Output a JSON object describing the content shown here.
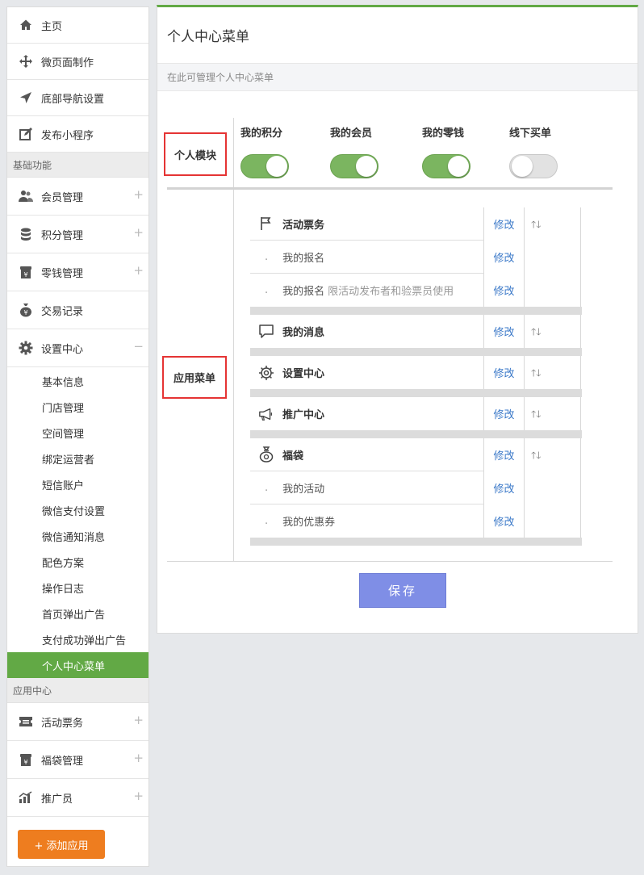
{
  "sidebar": {
    "top_items": [
      {
        "label": "主页",
        "icon": "home-icon"
      },
      {
        "label": "微页面制作",
        "icon": "move-icon"
      },
      {
        "label": "底部导航设置",
        "icon": "navigation-arrow-icon"
      },
      {
        "label": "发布小程序",
        "icon": "edit-icon"
      }
    ],
    "section_basic": "基础功能",
    "basic_items": [
      {
        "label": "会员管理",
        "icon": "users-icon",
        "toggle": "+"
      },
      {
        "label": "积分管理",
        "icon": "database-icon",
        "toggle": "+"
      },
      {
        "label": "零钱管理",
        "icon": "wallet-icon",
        "toggle": "+"
      },
      {
        "label": "交易记录",
        "icon": "money-bag-icon",
        "toggle": ""
      },
      {
        "label": "设置中心",
        "icon": "gear-icon",
        "toggle": "−"
      }
    ],
    "settings_subitems": [
      "基本信息",
      "门店管理",
      "空间管理",
      "绑定运营者",
      "短信账户",
      "微信支付设置",
      "微信通知消息",
      "配色方案",
      "操作日志",
      "首页弹出广告",
      "支付成功弹出广告",
      "个人中心菜单"
    ],
    "section_apps": "应用中心",
    "app_items": [
      {
        "label": "活动票务",
        "icon": "ticket-icon",
        "toggle": "+"
      },
      {
        "label": "福袋管理",
        "icon": "lucky-bag-icon",
        "toggle": "+"
      },
      {
        "label": "推广员",
        "icon": "bar-chart-icon",
        "toggle": "+"
      }
    ],
    "add_app_label": "+ 添加应用"
  },
  "main": {
    "title": "个人中心菜单",
    "description": "在此可管理个人中心菜单",
    "personal_module_label": "个人模块",
    "app_menu_label": "应用菜单",
    "modules": [
      {
        "label": "我的积分",
        "enabled": true
      },
      {
        "label": "我的会员",
        "enabled": true
      },
      {
        "label": "我的零钱",
        "enabled": true
      },
      {
        "label": "线下买单",
        "enabled": false
      }
    ],
    "edit_label": "修改",
    "sort_label": "🡑🡓",
    "menus": [
      {
        "name": "活动票务",
        "icon": "flag-icon",
        "children": [
          {
            "name": "我的报名",
            "note": ""
          },
          {
            "name": "我的报名",
            "note": "限活动发布者和验票员使用"
          }
        ]
      },
      {
        "name": "我的消息",
        "icon": "message-icon",
        "children": []
      },
      {
        "name": "设置中心",
        "icon": "gear-icon",
        "children": []
      },
      {
        "name": "推广中心",
        "icon": "megaphone-icon",
        "children": []
      },
      {
        "name": "福袋",
        "icon": "lucky-bag-icon",
        "children": [
          {
            "name": "我的活动",
            "note": ""
          },
          {
            "name": "我的优惠券",
            "note": ""
          }
        ]
      }
    ],
    "sub_dot": ".",
    "save_label": "保存"
  },
  "colors": {
    "accent_green": "#62a945",
    "toggle_on": "#7bb560",
    "add_button": "#ee7d1f",
    "save_button": "#7f8ee6",
    "link_blue": "#3a78c8",
    "highlight_red": "#e53434"
  }
}
